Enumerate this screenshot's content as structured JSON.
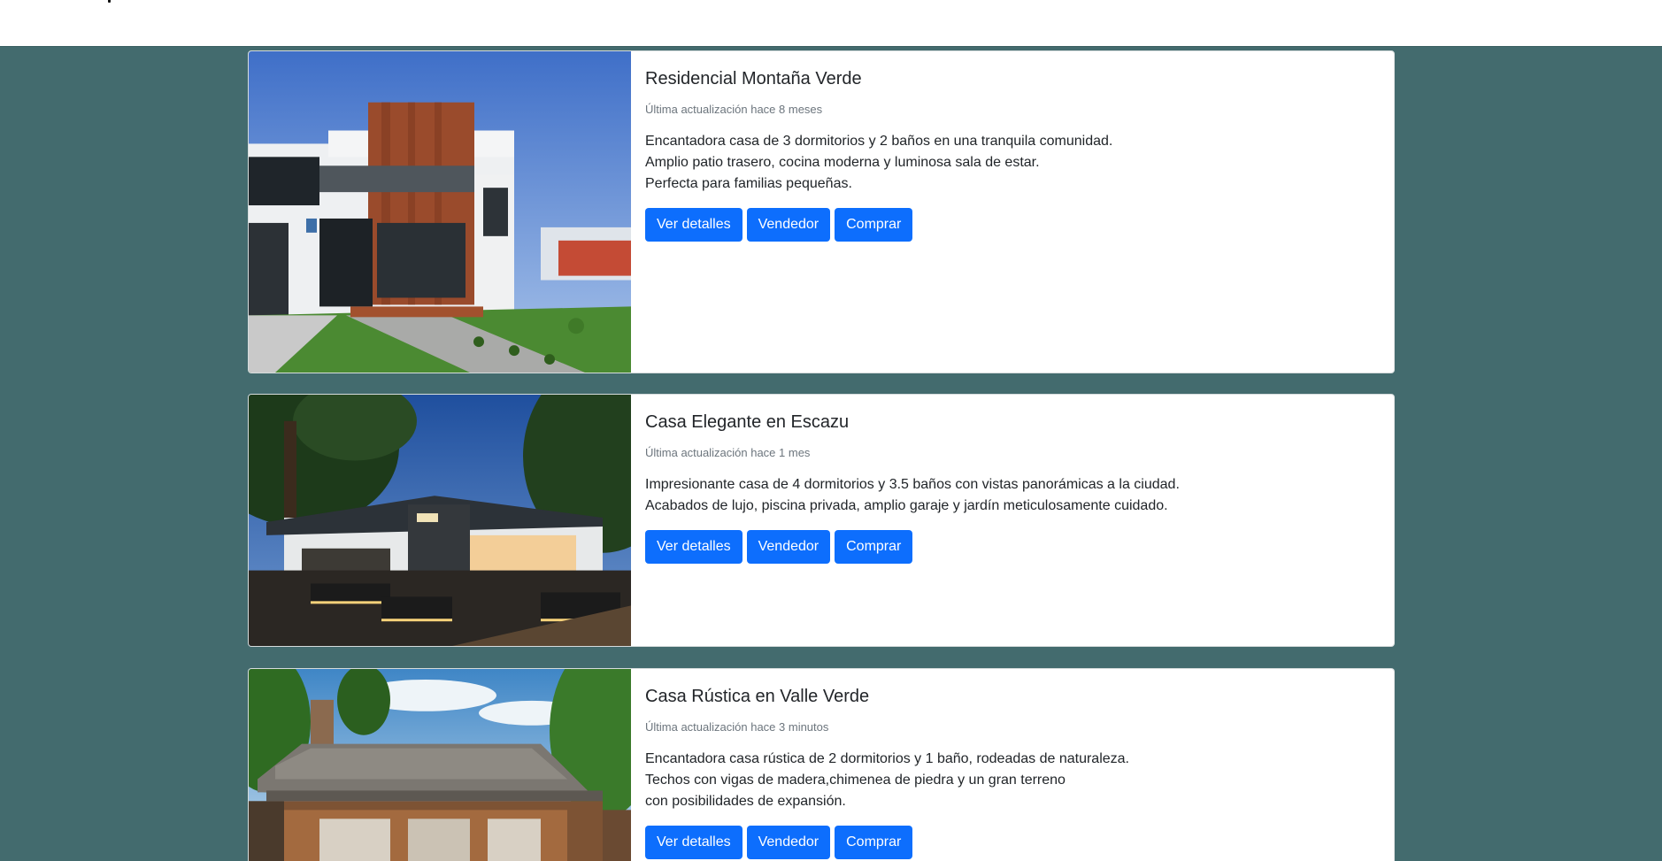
{
  "listings": [
    {
      "title": "Residencial Montaña Verde",
      "updated": "Última actualización hace 8 meses",
      "description": [
        "Encantadora casa de 3 dormitorios y 2 baños en una tranquila comunidad.",
        "Amplio patio trasero, cocina moderna y luminosa sala de estar.",
        "Perfecta para familias pequeñas."
      ],
      "buttons": {
        "details": "Ver detalles",
        "seller": "Vendedor",
        "buy": "Comprar"
      }
    },
    {
      "title": "Casa Elegante en Escazu",
      "updated": "Última actualización hace 1 mes",
      "description": [
        "Impresionante casa de 4 dormitorios y 3.5 baños con vistas panorámicas a la ciudad.",
        "Acabados de lujo, piscina privada, amplio garaje y jardín meticulosamente cuidado."
      ],
      "buttons": {
        "details": "Ver detalles",
        "seller": "Vendedor",
        "buy": "Comprar"
      }
    },
    {
      "title": "Casa Rústica en Valle Verde",
      "updated": "Última actualización hace 3 minutos",
      "description": [
        "Encantadora casa rústica de 2 dormitorios y 1 baño, rodeadas de naturaleza.",
        "Techos con vigas de madera,chimenea de piedra y un gran terreno",
        "con posibilidades de expansión."
      ],
      "buttons": {
        "details": "Ver detalles",
        "seller": "Vendedor",
        "buy": "Comprar"
      }
    }
  ],
  "colors": {
    "page_background": "#436b6e",
    "button": "#0d6efd",
    "card": "#ffffff",
    "muted_text": "#6c757d"
  }
}
